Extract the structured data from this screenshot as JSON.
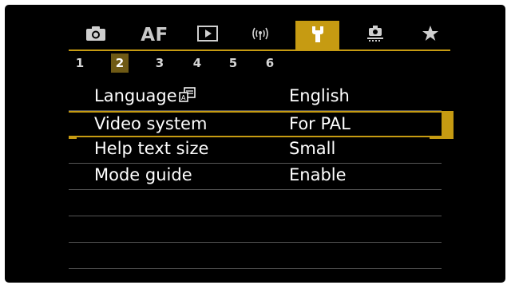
{
  "tabs": [
    {
      "name": "shooting",
      "icon": "camera-icon",
      "label": ""
    },
    {
      "name": "af",
      "icon": "",
      "label": "AF"
    },
    {
      "name": "playback",
      "icon": "play-icon",
      "label": ""
    },
    {
      "name": "wireless",
      "icon": "wireless-icon",
      "label": ""
    },
    {
      "name": "setup",
      "icon": "wrench-icon",
      "label": ""
    },
    {
      "name": "custom",
      "icon": "custom-functions-icon",
      "label": ""
    },
    {
      "name": "my-menu",
      "icon": "star-icon",
      "label": ""
    }
  ],
  "active_tab": "setup",
  "pages": [
    "1",
    "2",
    "3",
    "4",
    "5",
    "6"
  ],
  "active_page": "2",
  "menu": {
    "items": [
      {
        "label": "Language",
        "value": "English",
        "icon": "language-icon"
      },
      {
        "label": "Video system",
        "value": "For PAL"
      },
      {
        "label": "Help text size",
        "value": "Small"
      },
      {
        "label": "Mode guide",
        "value": "Enable"
      }
    ],
    "selected_index": 1,
    "empty_rows": 3
  },
  "colors": {
    "accent": "#c69b12",
    "page_highlight": "#6f5a15",
    "background": "#000000",
    "text": "#ffffff"
  }
}
